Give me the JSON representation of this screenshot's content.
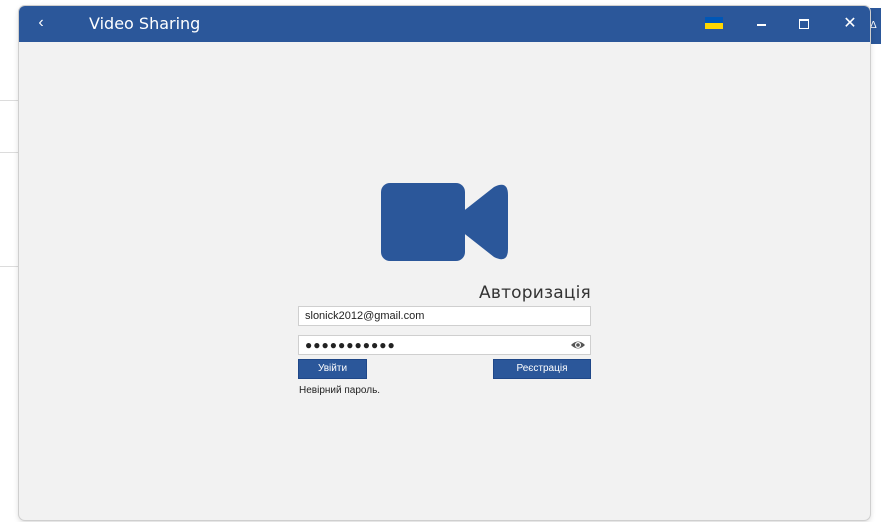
{
  "window": {
    "title": "Video Sharing",
    "back_glyph": "‹",
    "close_glyph": "✕",
    "language_flag": "ukraine-flag-icon",
    "accent_color": "#2b579a",
    "background_color": "#f2f2f2"
  },
  "background": {
    "edge_glyph": "Δ"
  },
  "login": {
    "icon": "video-camera-icon",
    "heading": "Авторизація",
    "email_value": "slonick2012@gmail.com",
    "password_value": "●●●●●●●●●●●",
    "show_password_icon": "eye-icon",
    "login_label": "Увійти",
    "register_label": "Реєстрація",
    "error_message": "Невірний пароль."
  }
}
